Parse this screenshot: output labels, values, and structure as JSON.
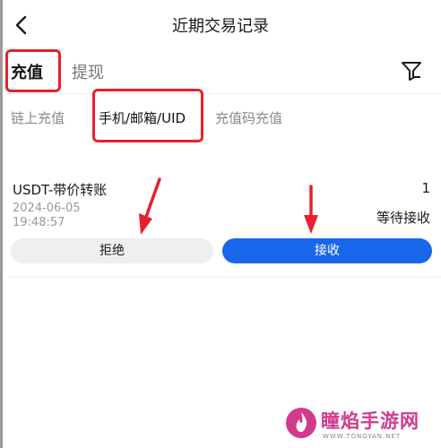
{
  "header": {
    "title": "近期交易记录",
    "back_icon": "chevron-left-icon"
  },
  "tabs": [
    {
      "label": "充值",
      "active": true
    },
    {
      "label": "提现",
      "active": false
    }
  ],
  "filter_icon": "filter-icon",
  "subtabs": [
    {
      "label": "链上充值",
      "active": false
    },
    {
      "label": "手机/邮箱/UID",
      "active": true
    },
    {
      "label": "充值码充值",
      "active": false
    }
  ],
  "record": {
    "name": "USDT-带价转账",
    "amount": "1",
    "date": "2024-06-05",
    "time": "19:48:57",
    "status": "等待接收",
    "reject_label": "拒绝",
    "accept_label": "接收"
  },
  "colors": {
    "accent": "#1966ea",
    "highlight": "#e8202d",
    "watermark": "#d23a8e"
  },
  "watermark": {
    "name": "瞳焰手游网",
    "url": "WWW.TONGYAN.NET"
  }
}
